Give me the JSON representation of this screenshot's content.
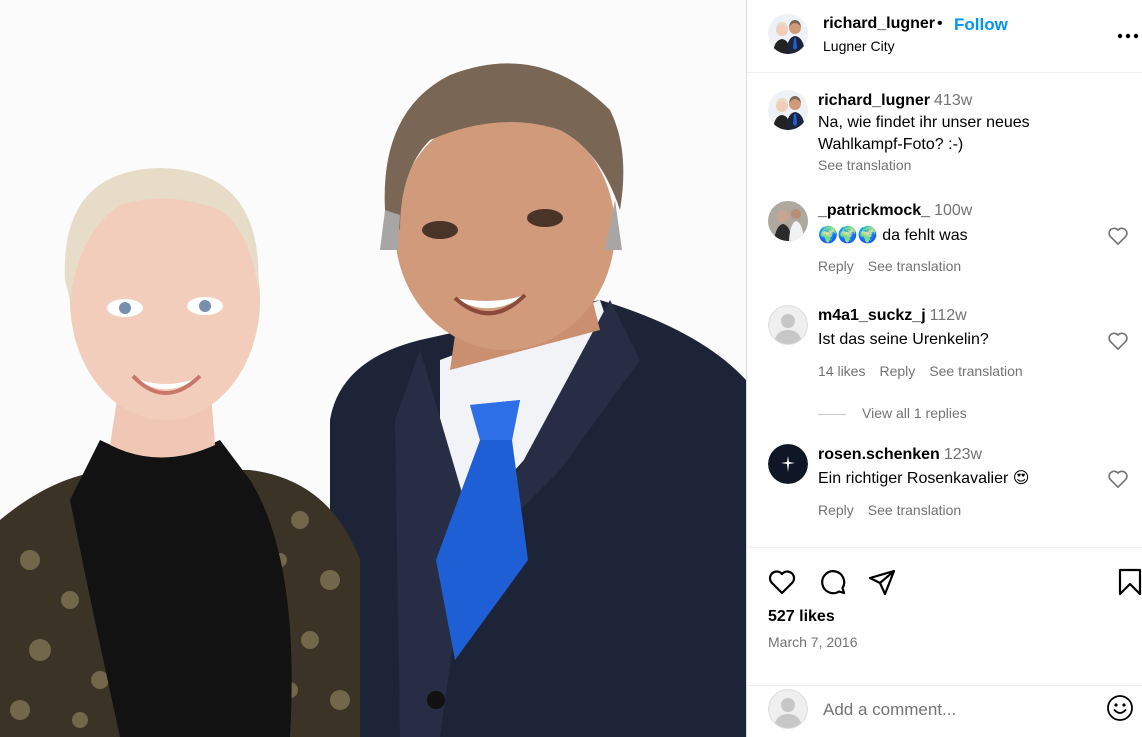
{
  "post": {
    "username": "richard_lugner",
    "dot": "•",
    "follow_label": "Follow",
    "location": "Lugner City"
  },
  "icons": {
    "more": "more-options-icon",
    "like": "heart-icon",
    "comment": "comment-icon",
    "share": "share-icon",
    "save": "bookmark-icon",
    "emoji": "emoji-icon"
  },
  "caption": {
    "username": "richard_lugner",
    "time": "413w",
    "text": "Na, wie findet ihr unser neues Wahlkampf-Foto? :-)",
    "see_translation": "See translation"
  },
  "comments": [
    {
      "username": "_patrickmock_",
      "time": "100w",
      "emoji": "🌍🌍🌍",
      "text": "da fehlt was",
      "reply": "Reply",
      "see_translation": "See translation"
    },
    {
      "username": "m4a1_suckz_j",
      "time": "112w",
      "text": "Ist das seine Urenkelin?",
      "likes": "14 likes",
      "reply": "Reply",
      "see_translation": "See translation",
      "view_replies": "View all 1 replies"
    },
    {
      "username": "rosen.schenken",
      "time": "123w",
      "text": "Ein richtiger Rosenkavalier",
      "emoji": "😍",
      "reply": "Reply",
      "see_translation": "See translation"
    }
  ],
  "footer": {
    "likes": "527 likes",
    "date": "March 7, 2016",
    "comment_placeholder": "Add a comment..."
  },
  "colors": {
    "accent": "#0095f6",
    "muted": "#737373",
    "border": "#dbdbdb"
  }
}
